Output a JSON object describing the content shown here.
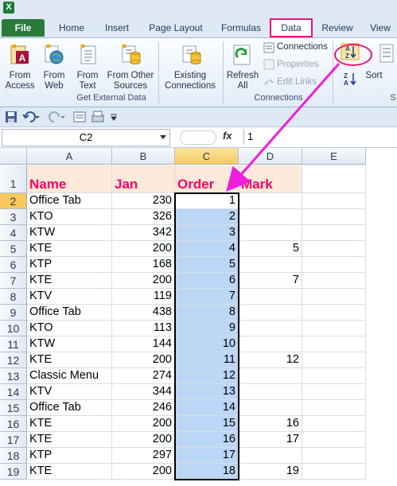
{
  "ribbon_tabs": [
    {
      "label": "File"
    },
    {
      "label": "Home"
    },
    {
      "label": "Insert"
    },
    {
      "label": "Page Layout"
    },
    {
      "label": "Formulas"
    },
    {
      "label": "Data"
    },
    {
      "label": "Review"
    },
    {
      "label": "View"
    }
  ],
  "groups": {
    "external": {
      "label": "Get External Data",
      "from_access": "From\nAccess",
      "from_web": "From\nWeb",
      "from_text": "From\nText",
      "from_other": "From Other\nSources",
      "existing": "Existing\nConnections"
    },
    "connections": {
      "label": "Connections",
      "refresh": "Refresh\nAll",
      "connections": "Connections",
      "properties": "Properties",
      "edit_links": "Edit Links"
    },
    "sort": {
      "sort": "Sort",
      "partial_label": "S"
    }
  },
  "formula_bar": {
    "name_box": "C2",
    "fx": "fx",
    "value": "1"
  },
  "columns": [
    "A",
    "B",
    "C",
    "D",
    "E"
  ],
  "header_row": {
    "a": "Name",
    "b": "Jan",
    "c": "Order",
    "d": "Mark"
  },
  "rows": [
    {
      "n": "2",
      "a": "Office Tab",
      "b": "230",
      "c": "1",
      "d": ""
    },
    {
      "n": "3",
      "a": "KTO",
      "b": "326",
      "c": "2",
      "d": ""
    },
    {
      "n": "4",
      "a": "KTW",
      "b": "342",
      "c": "3",
      "d": ""
    },
    {
      "n": "5",
      "a": "KTE",
      "b": "200",
      "c": "4",
      "d": "5"
    },
    {
      "n": "6",
      "a": "KTP",
      "b": "168",
      "c": "5",
      "d": ""
    },
    {
      "n": "7",
      "a": "KTE",
      "b": "200",
      "c": "6",
      "d": "7"
    },
    {
      "n": "8",
      "a": "KTV",
      "b": "119",
      "c": "7",
      "d": ""
    },
    {
      "n": "9",
      "a": "Office Tab",
      "b": "438",
      "c": "8",
      "d": ""
    },
    {
      "n": "10",
      "a": "KTO",
      "b": "113",
      "c": "9",
      "d": ""
    },
    {
      "n": "11",
      "a": "KTW",
      "b": "144",
      "c": "10",
      "d": ""
    },
    {
      "n": "12",
      "a": "KTE",
      "b": "200",
      "c": "11",
      "d": "12"
    },
    {
      "n": "13",
      "a": "Classic Menu",
      "b": "274",
      "c": "12",
      "d": ""
    },
    {
      "n": "14",
      "a": "KTV",
      "b": "344",
      "c": "13",
      "d": ""
    },
    {
      "n": "15",
      "a": "Office Tab",
      "b": "246",
      "c": "14",
      "d": ""
    },
    {
      "n": "16",
      "a": "KTE",
      "b": "200",
      "c": "15",
      "d": "16"
    },
    {
      "n": "17",
      "a": "KTE",
      "b": "200",
      "c": "16",
      "d": "17"
    },
    {
      "n": "18",
      "a": "KTP",
      "b": "297",
      "c": "17",
      "d": ""
    },
    {
      "n": "19",
      "a": "KTE",
      "b": "200",
      "c": "18",
      "d": "19"
    }
  ],
  "colors": {
    "accent": "#e8157a",
    "header_text": "#ff0066",
    "header_fill": "#fde9d9",
    "selection": "#bcd7f5",
    "file_tab": "#2a7a3b"
  }
}
